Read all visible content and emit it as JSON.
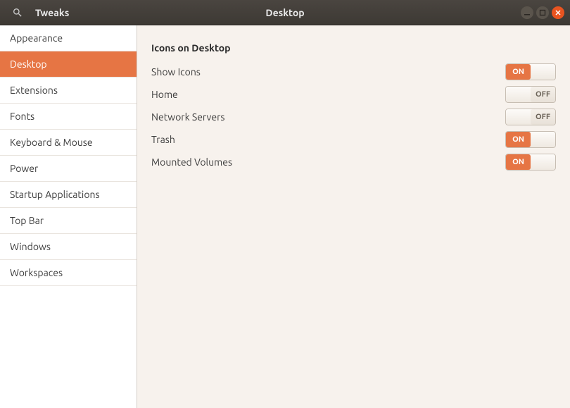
{
  "header": {
    "app_title": "Tweaks",
    "page_title": "Desktop"
  },
  "sidebar": {
    "items": [
      {
        "label": "Appearance",
        "active": false
      },
      {
        "label": "Desktop",
        "active": true
      },
      {
        "label": "Extensions",
        "active": false
      },
      {
        "label": "Fonts",
        "active": false
      },
      {
        "label": "Keyboard & Mouse",
        "active": false
      },
      {
        "label": "Power",
        "active": false
      },
      {
        "label": "Startup Applications",
        "active": false
      },
      {
        "label": "Top Bar",
        "active": false
      },
      {
        "label": "Windows",
        "active": false
      },
      {
        "label": "Workspaces",
        "active": false
      }
    ]
  },
  "content": {
    "section_title": "Icons on Desktop",
    "rows": [
      {
        "label": "Show Icons",
        "state": "ON"
      },
      {
        "label": "Home",
        "state": "OFF"
      },
      {
        "label": "Network Servers",
        "state": "OFF"
      },
      {
        "label": "Trash",
        "state": "ON"
      },
      {
        "label": "Mounted Volumes",
        "state": "ON"
      }
    ]
  },
  "toggle_labels": {
    "on": "ON",
    "off": "OFF"
  }
}
